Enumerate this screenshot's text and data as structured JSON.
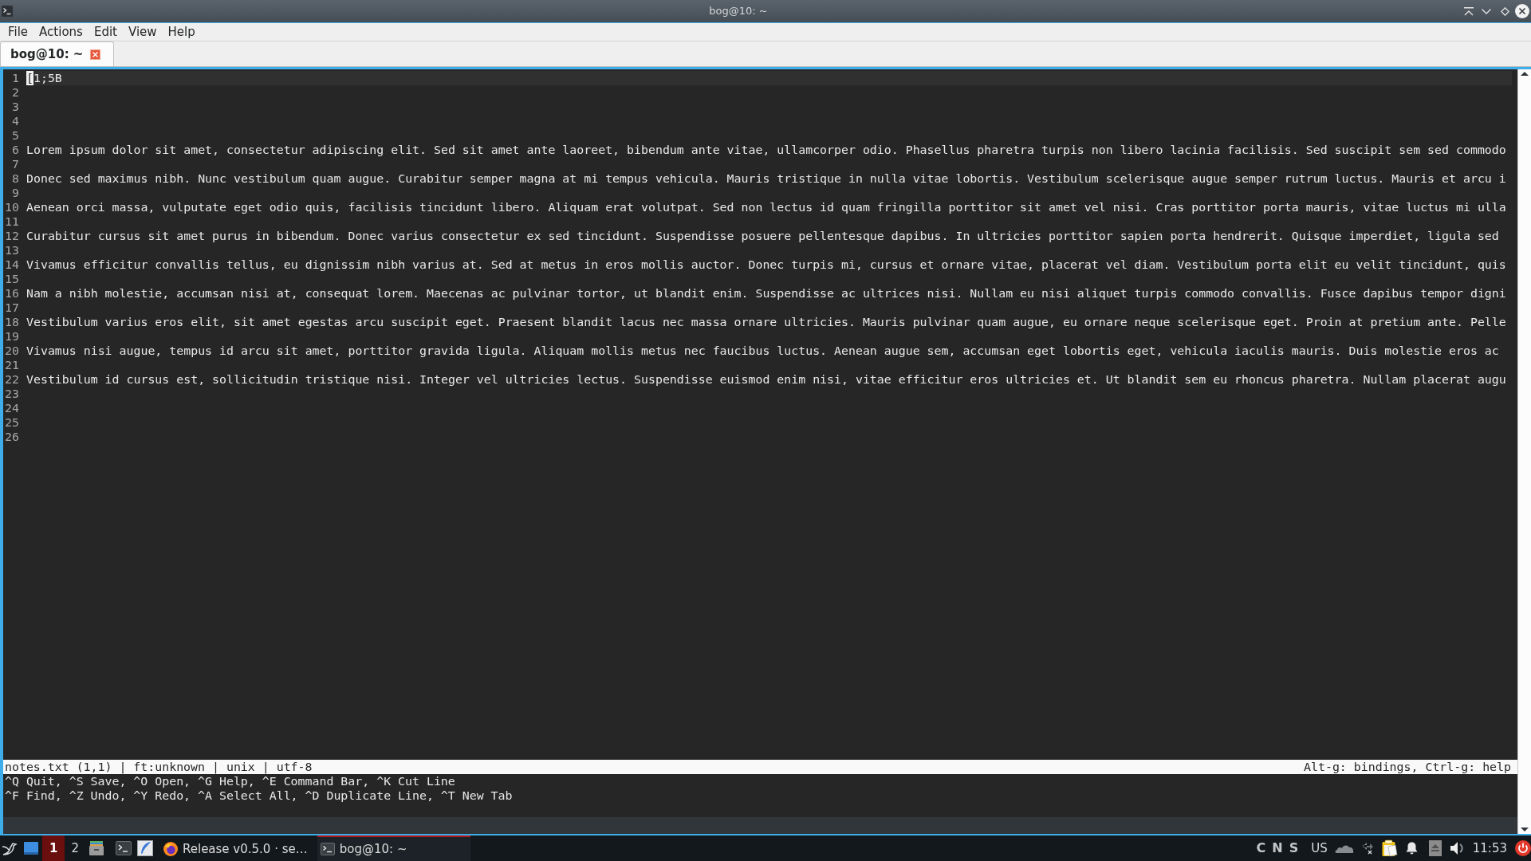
{
  "window": {
    "title": "bog@10: ~"
  },
  "menu": [
    "File",
    "Actions",
    "Edit",
    "View",
    "Help"
  ],
  "tabs": [
    {
      "label": "bog@10: ~",
      "selected": true
    }
  ],
  "editor": {
    "lines": [
      {
        "number": "1",
        "text": "[1;5B",
        "cursor": true
      },
      {
        "number": "2",
        "cursor": false
      },
      {
        "number": "3",
        "cursor": false
      },
      {
        "number": "4",
        "cursor": false
      },
      {
        "number": "5",
        "cursor": false
      },
      {
        "number": "6",
        "text": "Lorem ipsum dolor sit amet, consectetur adipiscing elit. Sed sit amet ante laoreet, bibendum ante vitae, ullamcorper odio. Phasellus pharetra turpis non libero lacinia facilisis. Sed suscipit sem sed commodo",
        "cursor": false
      },
      {
        "number": "7",
        "cursor": false
      },
      {
        "number": "8",
        "text": "Donec sed maximus nibh. Nunc vestibulum quam augue. Curabitur semper magna at mi tempus vehicula. Mauris tristique in nulla vitae lobortis. Vestibulum scelerisque augue semper rutrum luctus. Mauris et arcu i",
        "cursor": false
      },
      {
        "number": "9",
        "cursor": false
      },
      {
        "number": "10",
        "text": "Aenean orci massa, vulputate eget odio quis, facilisis tincidunt libero. Aliquam erat volutpat. Sed non lectus id quam fringilla porttitor sit amet vel nisi. Cras porttitor porta mauris, vitae luctus mi ulla",
        "cursor": false
      },
      {
        "number": "11",
        "cursor": false
      },
      {
        "number": "12",
        "text": "Curabitur cursus sit amet purus in bibendum. Donec varius consectetur ex sed tincidunt. Suspendisse posuere pellentesque dapibus. In ultricies porttitor sapien porta hendrerit. Quisque imperdiet, ligula sed",
        "cursor": false
      },
      {
        "number": "13",
        "cursor": false
      },
      {
        "number": "14",
        "text": "Vivamus efficitur convallis tellus, eu dignissim nibh varius at. Sed at metus in eros mollis auctor. Donec turpis mi, cursus et ornare vitae, placerat vel diam. Vestibulum porta elit eu velit tincidunt, quis",
        "cursor": false
      },
      {
        "number": "15",
        "cursor": false
      },
      {
        "number": "16",
        "text": "Nam a nibh molestie, accumsan nisi at, consequat lorem. Maecenas ac pulvinar tortor, ut blandit enim. Suspendisse ac ultrices nisi. Nullam eu nisi aliquet turpis commodo convallis. Fusce dapibus tempor digni",
        "cursor": false
      },
      {
        "number": "17",
        "cursor": false
      },
      {
        "number": "18",
        "text": "Vestibulum varius eros elit, sit amet egestas arcu suscipit eget. Praesent blandit lacus nec massa ornare ultricies. Mauris pulvinar quam augue, eu ornare neque scelerisque eget. Proin at pretium ante. Pelle",
        "cursor": false
      },
      {
        "number": "19",
        "cursor": false
      },
      {
        "number": "20",
        "text": "Vivamus nisi augue, tempus id arcu sit amet, porttitor gravida ligula. Aliquam mollis metus nec faucibus luctus. Aenean augue sem, accumsan eget lobortis eget, vehicula iaculis mauris. Duis molestie eros ac",
        "cursor": false
      },
      {
        "number": "21",
        "cursor": false
      },
      {
        "number": "22",
        "text": "Vestibulum id cursus est, sollicitudin tristique nisi. Integer vel ultricies lectus. Suspendisse euismod enim nisi, vitae efficitur eros ultricies et. Ut blandit sem eu rhoncus pharetra. Nullam placerat augu",
        "cursor": false
      },
      {
        "number": "23",
        "cursor": false
      },
      {
        "number": "24",
        "cursor": false
      },
      {
        "number": "25",
        "cursor": false
      },
      {
        "number": "26",
        "cursor": false
      }
    ]
  },
  "status_bar": {
    "left": "notes.txt (1,1) | ft:unknown | unix | utf-8",
    "right": "Alt-g: bindings, Ctrl-g: help"
  },
  "help_lines": [
    "^Q Quit, ^S Save, ^O Open, ^G Help, ^E Command Bar, ^K Cut Line",
    "^F Find, ^Z Undo, ^Y Redo, ^A Select All, ^D Duplicate Line, ^T New Tab"
  ],
  "taskbar": {
    "workspaces": [
      {
        "label": "1",
        "selected": true
      },
      {
        "label": "2",
        "selected": false
      }
    ],
    "tasks": [
      {
        "kind": "browser",
        "label": "Release v0.5.0 · se…",
        "selected": false
      },
      {
        "kind": "terminal",
        "label": "bog@10: ~",
        "selected": true
      }
    ],
    "lock_indicators": [
      "C",
      "N",
      "S"
    ],
    "keyboard_layout": "US",
    "clock": "11:53"
  }
}
